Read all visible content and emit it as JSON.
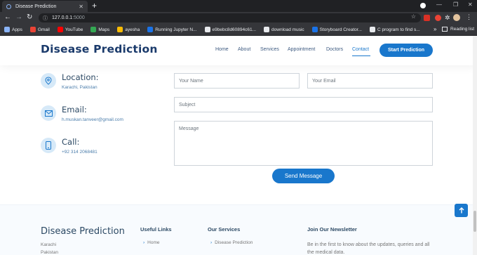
{
  "browser": {
    "tab_title": "Disease Prediction",
    "tab_close": "✕",
    "new_tab": "+",
    "url_host": "127.0.0.1",
    "url_port": ":5000",
    "bookmarks": [
      {
        "label": "Apps",
        "color": "#8ab4f8"
      },
      {
        "label": "Gmail",
        "color": "#ea4335"
      },
      {
        "label": "YouTube",
        "color": "#ff0000"
      },
      {
        "label": "Maps",
        "color": "#34a853"
      },
      {
        "label": "ayesha",
        "color": "#fbbc04"
      },
      {
        "label": "Running Jupyter N...",
        "color": "#1a73e8"
      },
      {
        "label": "e9bebc8d60894c61...",
        "color": "#e8eaed"
      },
      {
        "label": "download music",
        "color": "#e8eaed"
      },
      {
        "label": "Storyboard Creator...",
        "color": "#1a73e8"
      },
      {
        "label": "C program to find s...",
        "color": "#e8eaed"
      }
    ],
    "reading_list": "Reading list",
    "more": "»"
  },
  "header": {
    "logo": "Disease Prediction",
    "nav": [
      "Home",
      "About",
      "Services",
      "Appointment",
      "Doctors",
      "Contact"
    ],
    "active_nav": "Contact",
    "cta": "Start Prediction"
  },
  "contact_info": {
    "location_title": "Location:",
    "location_text": "Karachi, Pakistan",
    "email_title": "Email:",
    "email_text": "h.muskan.tanveer@gmail.com",
    "call_title": "Call:",
    "call_text": "+92 314 2068481"
  },
  "form": {
    "name_placeholder": "Your Name",
    "email_placeholder": "Your Email",
    "subject_placeholder": "Subject",
    "message_placeholder": "Message",
    "submit": "Send Message"
  },
  "footer": {
    "brand": "Disease Prediction",
    "address_1": "Karachi",
    "address_2": "Pakistan",
    "useful_links_title": "Useful Links",
    "useful_link_1": "Home",
    "services_title": "Our Services",
    "service_1": "Disease Prediction",
    "newsletter_title": "Join Our Newsletter",
    "newsletter_text": "Be in the first to know about the updates, queries and all the medical data."
  },
  "colors": {
    "primary": "#1977cc",
    "heading": "#2c4964",
    "logo": "#1a3a6b"
  }
}
